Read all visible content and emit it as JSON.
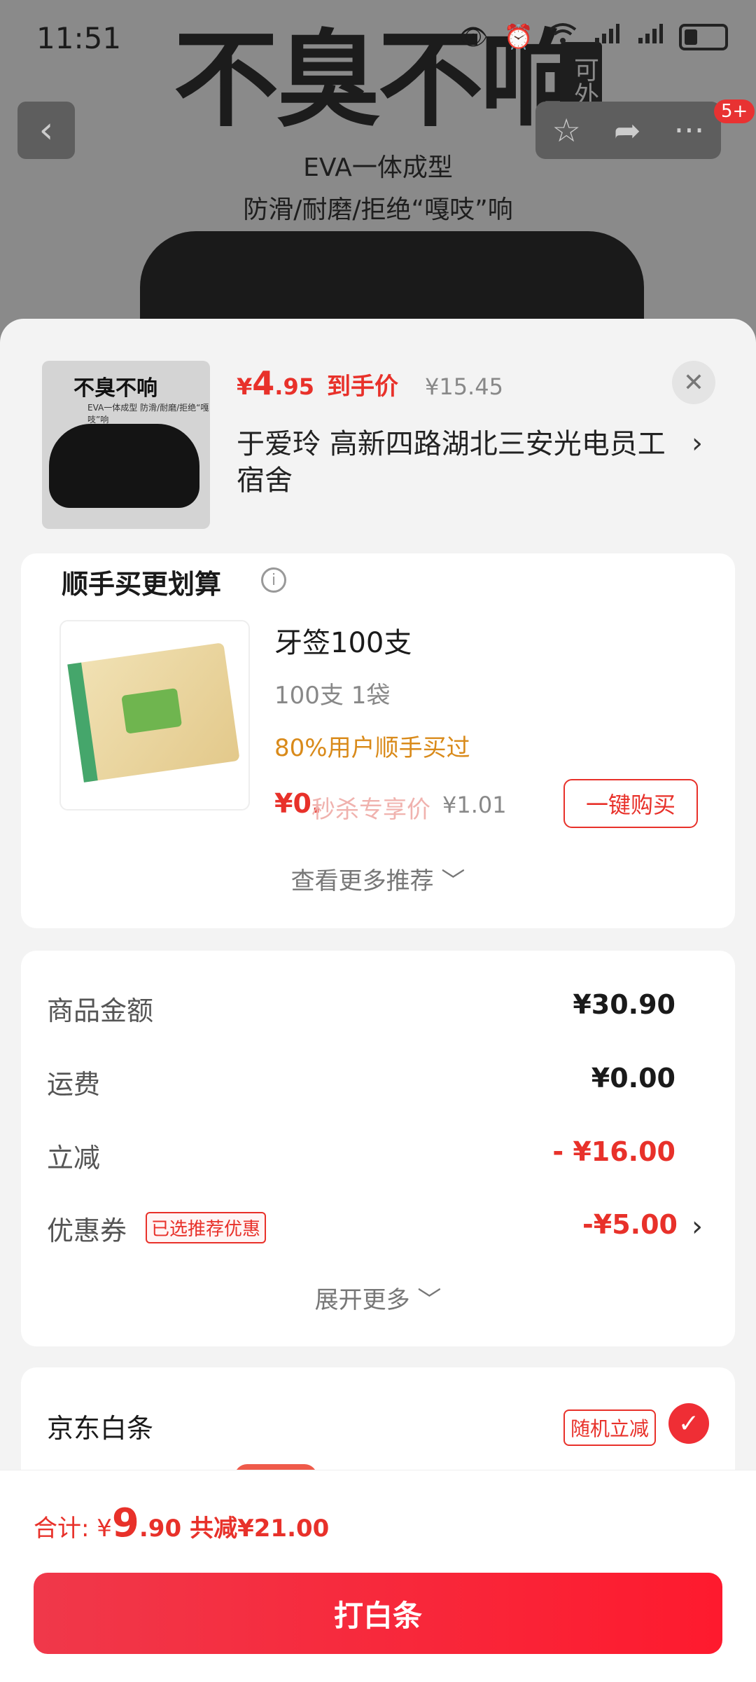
{
  "status_bar": {
    "time": "11:51"
  },
  "background_product": {
    "banner_title": "不臭不响",
    "banner_side_tag": "可外穿",
    "banner_line1": "EVA一体成型",
    "banner_line2": "防滑/耐磨/拒绝“嘎吱”响",
    "notification_count": "5+"
  },
  "selected_product": {
    "thumb_title": "不臭不响",
    "thumb_sub": "EVA一体成型 防滑/耐磨/拒绝“嘎吱”响",
    "price_symbol": "¥",
    "price_int": "4",
    "price_dec": ".95",
    "price_label": "到手价",
    "original_price": "¥15.45",
    "address": "于爱玲  高新四路湖北三安光电员工宿舍"
  },
  "recommendations": {
    "header": "顺手买更划算",
    "item": {
      "name": "牙签100支",
      "spec": "100支 1袋",
      "bought_rate": "80%用户顺手买过",
      "price": "¥0.",
      "price_label": "秒杀专享价",
      "original_price": "¥1.01",
      "buy_button": "一键购买"
    },
    "more_link": "查看更多推荐"
  },
  "summary": {
    "rows": [
      {
        "label": "商品金额",
        "value": "¥30.90"
      },
      {
        "label": "运费",
        "value": "¥0.00"
      },
      {
        "label": "立减",
        "value": "- ¥16.00"
      },
      {
        "label": "优惠券",
        "value": "-¥5.00"
      }
    ],
    "coupon_badge": "已选推荐优惠",
    "expand_link": "展开更多"
  },
  "payment": {
    "method": "京东白条",
    "badge": "随机立减"
  },
  "footer": {
    "total_prefix": "合计: ¥",
    "total_int": "9",
    "total_dec": ".90",
    "total_saved": "共减¥21.00",
    "pay_button": "打白条"
  },
  "colors": {
    "accent": "#e8312a",
    "button_gradient_start": "#f0384a",
    "button_gradient_end": "#fe1a2e"
  }
}
